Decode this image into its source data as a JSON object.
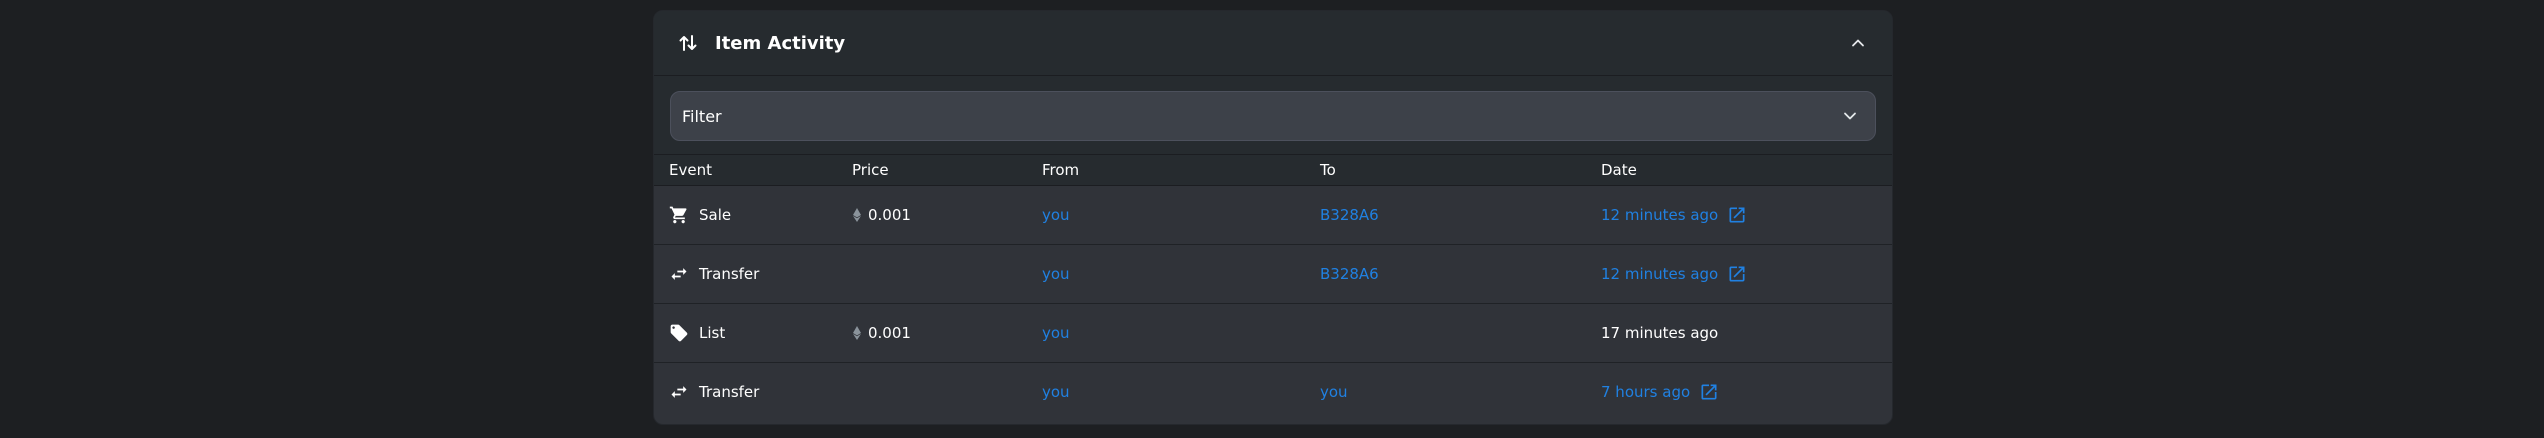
{
  "panel": {
    "title": "Item Activity",
    "header_icon": "swap-vertical-icon",
    "collapse_icon": "chevron-up-icon"
  },
  "filter": {
    "label": "Filter",
    "icon": "chevron-down-icon"
  },
  "table": {
    "columns": [
      "Event",
      "Price",
      "From",
      "To",
      "Date"
    ],
    "rows": [
      {
        "event": "Sale",
        "event_icon": "cart-icon",
        "price": "0.001",
        "from": "you",
        "to": "B328A6",
        "date": "12 minutes ago",
        "date_link": true
      },
      {
        "event": "Transfer",
        "event_icon": "transfer-icon",
        "price": "",
        "from": "you",
        "to": "B328A6",
        "date": "12 minutes ago",
        "date_link": true
      },
      {
        "event": "List",
        "event_icon": "tag-icon",
        "price": "0.001",
        "from": "you",
        "to": "",
        "date": "17 minutes ago",
        "date_link": false
      },
      {
        "event": "Transfer",
        "event_icon": "transfer-icon",
        "price": "",
        "from": "you",
        "to": "you",
        "date": "7 hours ago",
        "date_link": true
      }
    ]
  },
  "colors": {
    "background": "#1d1f22",
    "panel": "#303339",
    "header": "#262b2f",
    "link": "#2081e2",
    "text": "#ffffff"
  }
}
